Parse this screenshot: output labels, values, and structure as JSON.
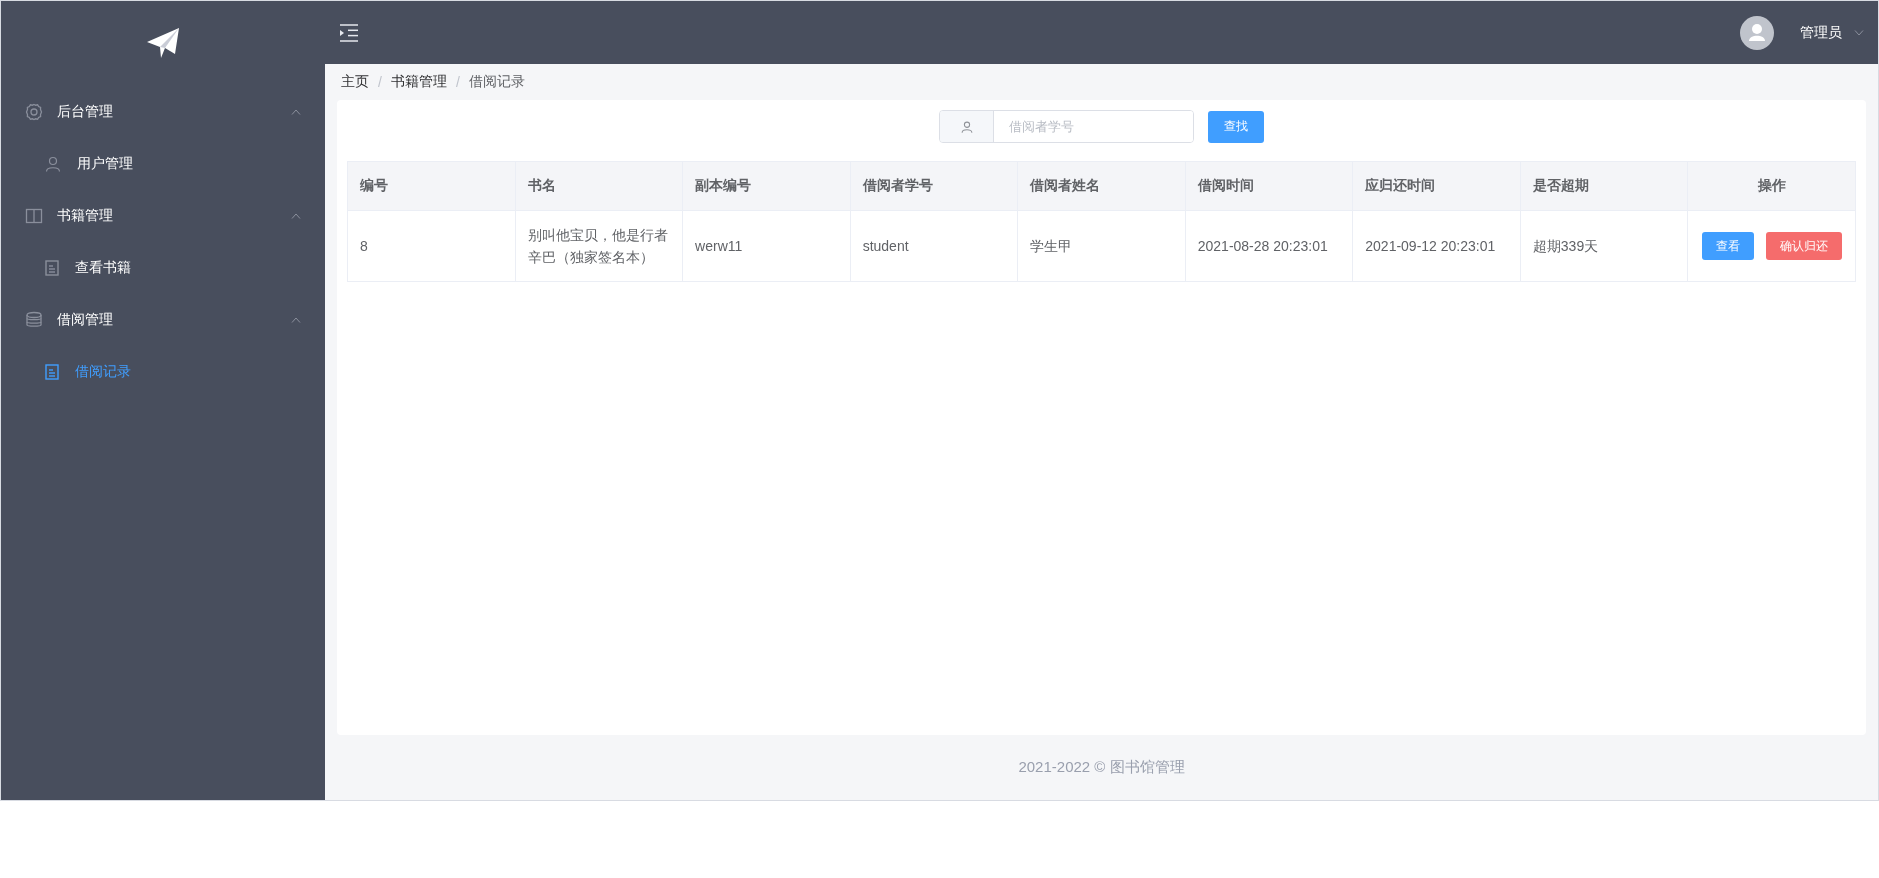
{
  "sidebar": {
    "groups": [
      {
        "label": "后台管理",
        "expanded": true,
        "children": [
          {
            "label": "用户管理",
            "selected": false
          }
        ]
      },
      {
        "label": "书籍管理",
        "expanded": true,
        "children": [
          {
            "label": "查看书籍",
            "selected": false
          }
        ]
      },
      {
        "label": "借阅管理",
        "expanded": true,
        "children": [
          {
            "label": "借阅记录",
            "selected": true
          }
        ]
      }
    ]
  },
  "header": {
    "user": "管理员"
  },
  "breadcrumb": [
    "主页",
    "书籍管理",
    "借阅记录"
  ],
  "breadcrumb_separator": "/",
  "search": {
    "placeholder": "借阅者学号",
    "button": "查找"
  },
  "table": {
    "columns": [
      "编号",
      "书名",
      "副本编号",
      "借阅者学号",
      "借阅者姓名",
      "借阅时间",
      "应归还时间",
      "是否超期",
      "操作"
    ],
    "rows": [
      {
        "cells": [
          "8",
          "别叫他宝贝，他是行者辛巴（独家签名本）",
          "werw11",
          "student",
          "学生甲",
          "2021-08-28 20:23:01",
          "2021-09-12 20:23:01",
          "超期339天"
        ],
        "actions": [
          {
            "label": "查看",
            "kind": "primary"
          },
          {
            "label": "确认归还",
            "kind": "danger"
          }
        ]
      }
    ]
  },
  "footer": "2021-2022 © 图书馆管理"
}
